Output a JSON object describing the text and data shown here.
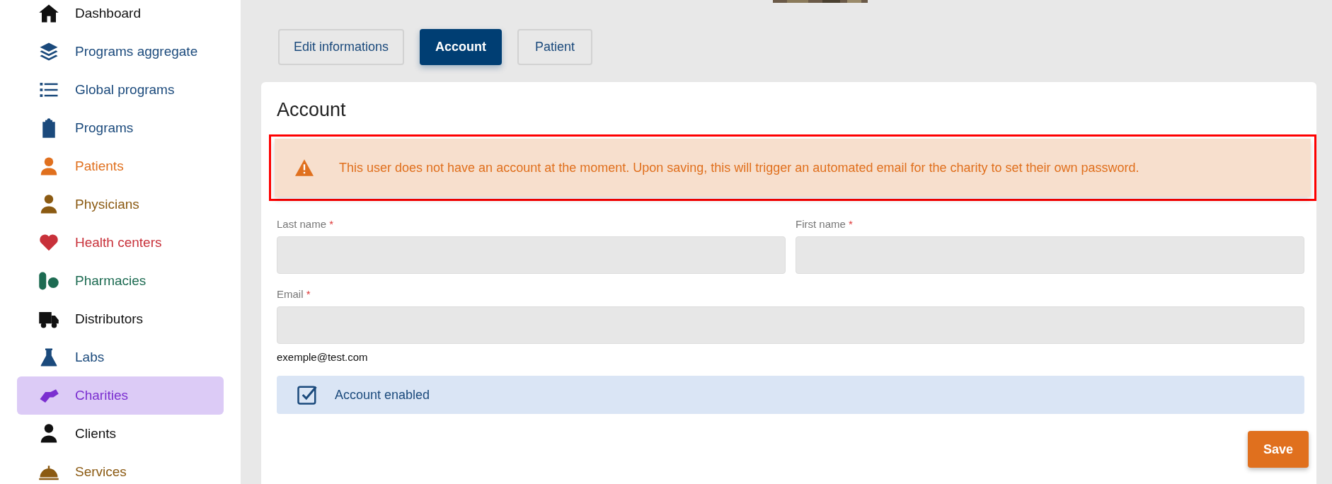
{
  "sidebar": {
    "items": [
      {
        "label": "Dashboard",
        "color": "#111111",
        "selected": false
      },
      {
        "label": "Programs aggregate",
        "color": "#1b4a7c",
        "selected": false
      },
      {
        "label": "Global programs",
        "color": "#1b4a7c",
        "selected": false
      },
      {
        "label": "Programs",
        "color": "#1b4a7c",
        "selected": false
      },
      {
        "label": "Patients",
        "color": "#e0701e",
        "selected": false
      },
      {
        "label": "Physicians",
        "color": "#8b5a12",
        "selected": false
      },
      {
        "label": "Health centers",
        "color": "#c8313a",
        "selected": false
      },
      {
        "label": "Pharmacies",
        "color": "#1d6b52",
        "selected": false
      },
      {
        "label": "Distributors",
        "color": "#111111",
        "selected": false
      },
      {
        "label": "Labs",
        "color": "#1b4a7c",
        "selected": false
      },
      {
        "label": "Charities",
        "color": "#7b2fd0",
        "selected": true
      },
      {
        "label": "Clients",
        "color": "#111111",
        "selected": false
      },
      {
        "label": "Services",
        "color": "#8b5a12",
        "selected": false
      }
    ]
  },
  "tabs": [
    {
      "label": "Edit informations",
      "selected": false
    },
    {
      "label": "Account",
      "selected": true
    },
    {
      "label": "Patient",
      "selected": false
    }
  ],
  "card": {
    "title": "Account",
    "alert": {
      "text": "This user does not have an account at the moment. Upon saving, this will trigger an automated email for the charity to set their own password.",
      "highlighted": true
    },
    "fields": [
      {
        "label": "Last name",
        "required_mark": "*"
      },
      {
        "label": "First name",
        "required_mark": "*"
      },
      {
        "label": "Email",
        "required_mark": "*",
        "helper": "exemple@test.com"
      }
    ],
    "checkbox": {
      "label": "Account enabled",
      "checked": true
    },
    "save_button": "Save"
  }
}
